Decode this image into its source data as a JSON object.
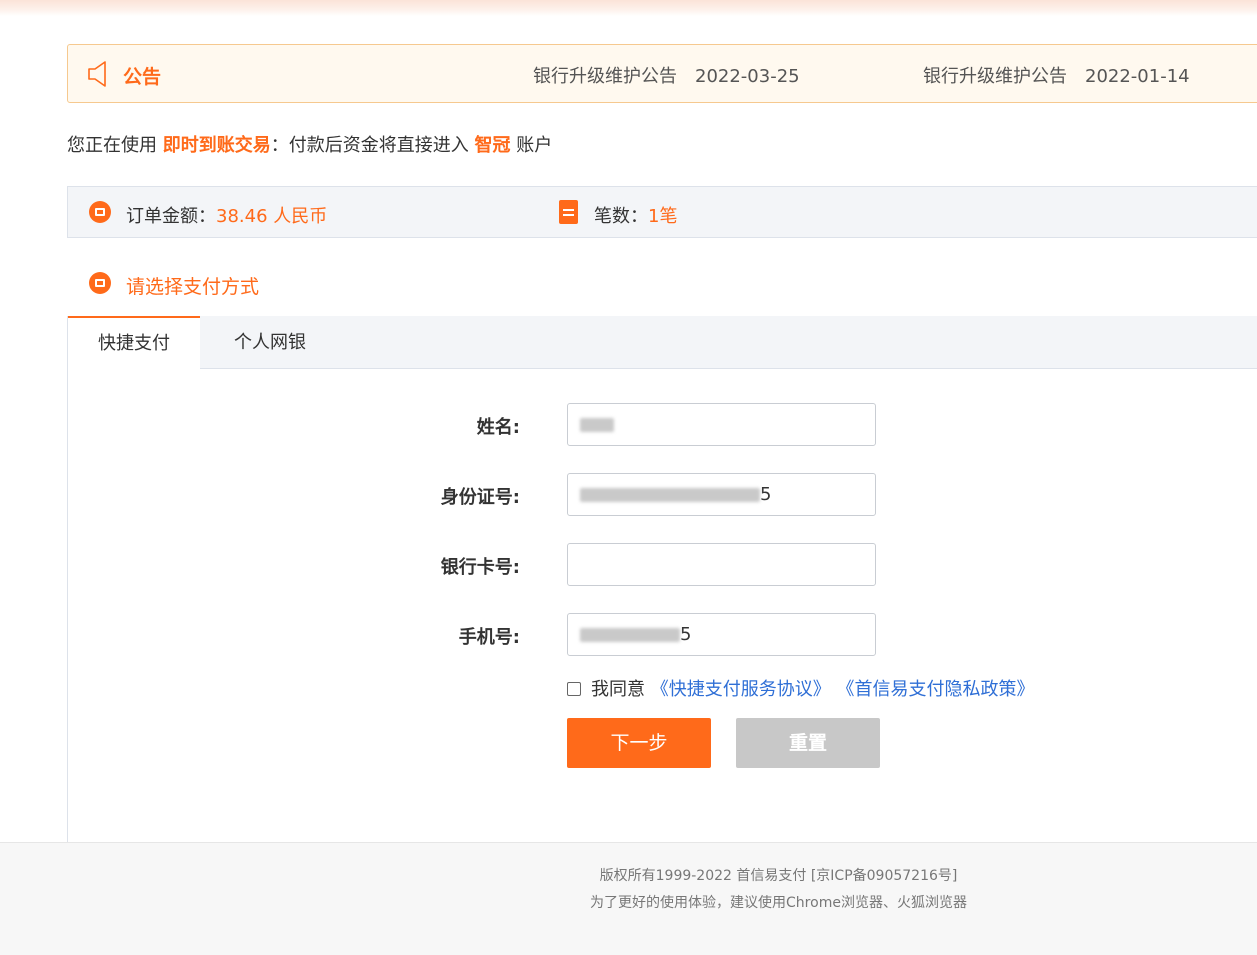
{
  "notice": {
    "title": "公告",
    "items": [
      {
        "text": "银行升级维护公告",
        "date": "2022-03-25"
      },
      {
        "text": "银行升级维护公告",
        "date": "2022-01-14"
      }
    ]
  },
  "usage": {
    "prefix": "您正在使用",
    "mode": "即时到账交易",
    "middle": "：付款后资金将直接进入",
    "merchant": "智冠",
    "suffix": "账户"
  },
  "order": {
    "amount_label": "订单金额：",
    "amount_value": "38.46 人民币",
    "count_label": "笔数：",
    "count_value": "1笔"
  },
  "section": {
    "title": "请选择支付方式"
  },
  "tabs": [
    {
      "label": "快捷支付",
      "active": true
    },
    {
      "label": "个人网银",
      "active": false
    }
  ],
  "form": {
    "name_label": "姓名:",
    "name_value_tail": "",
    "id_label": "身份证号:",
    "id_value_tail": "5",
    "card_label": "银行卡号:",
    "card_value": "",
    "phone_label": "手机号:",
    "phone_value_tail": "5"
  },
  "agreement": {
    "checked": false,
    "text": "我同意",
    "link1": "《快捷支付服务协议》",
    "link2": "《首信易支付隐私政策》"
  },
  "buttons": {
    "next": "下一步",
    "reset": "重置"
  },
  "footer": {
    "line1": "版权所有1999-2022 首信易支付 [京ICP备09057216号]",
    "line2": "为了更好的使用体验，建议使用Chrome浏览器、火狐浏览器"
  },
  "colors": {
    "accent": "#ff6a1a",
    "link": "#2f6fd6",
    "reset_bg": "#c8c8c8"
  }
}
